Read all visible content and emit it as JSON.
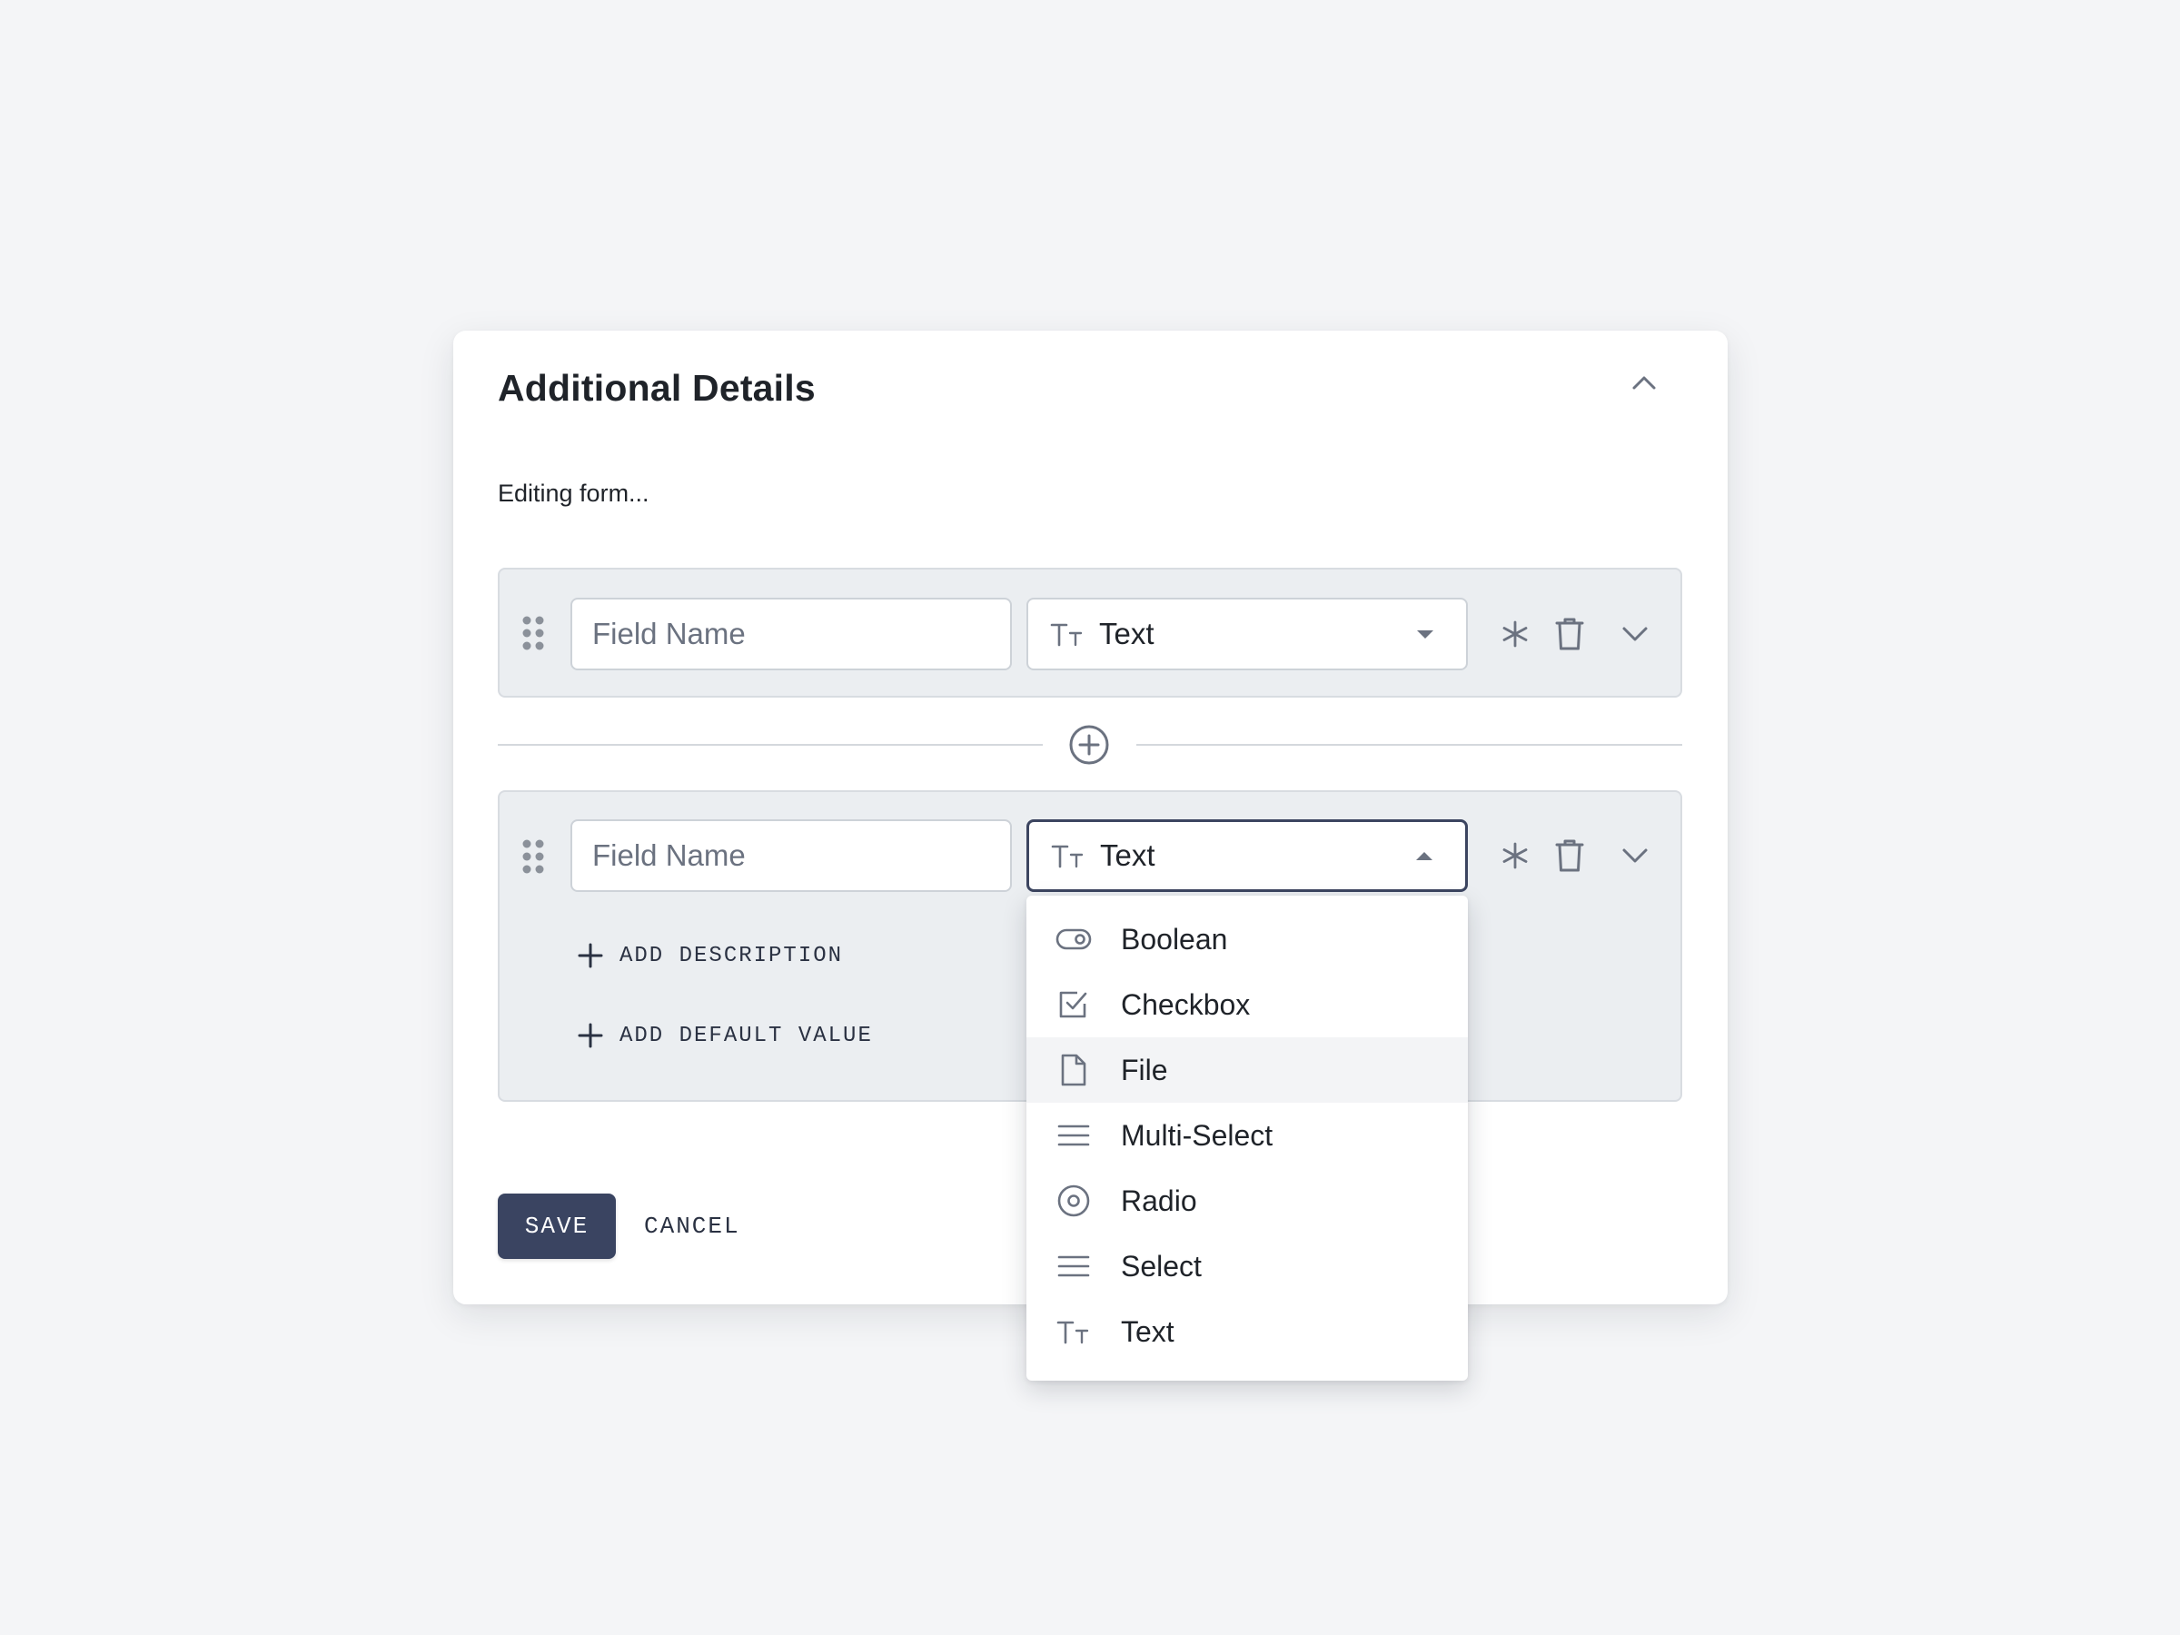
{
  "card": {
    "title": "Additional Details",
    "status": "Editing form..."
  },
  "fields": [
    {
      "name_placeholder": "Field Name",
      "type_label": "Text",
      "type_icon": "text-type-icon",
      "dropdown_open": false
    },
    {
      "name_placeholder": "Field Name",
      "type_label": "Text",
      "type_icon": "text-type-icon",
      "dropdown_open": true,
      "add_description_label": "ADD DESCRIPTION",
      "add_default_value_label": "ADD DEFAULT VALUE"
    }
  ],
  "type_options": [
    {
      "label": "Boolean",
      "icon": "toggle-icon"
    },
    {
      "label": "Checkbox",
      "icon": "checkbox-icon"
    },
    {
      "label": "File",
      "icon": "file-icon",
      "highlighted": true
    },
    {
      "label": "Multi-Select",
      "icon": "list-icon"
    },
    {
      "label": "Radio",
      "icon": "radio-icon"
    },
    {
      "label": "Select",
      "icon": "list-icon"
    },
    {
      "label": "Text",
      "icon": "text-type-icon"
    }
  ],
  "actions": {
    "save_label": "SAVE",
    "cancel_label": "CANCEL"
  },
  "colors": {
    "background": "#f4f5f7",
    "card": "#ffffff",
    "row_background": "#ebeef1",
    "primary_button": "#3a4461",
    "icon_gray": "#6b7280"
  }
}
